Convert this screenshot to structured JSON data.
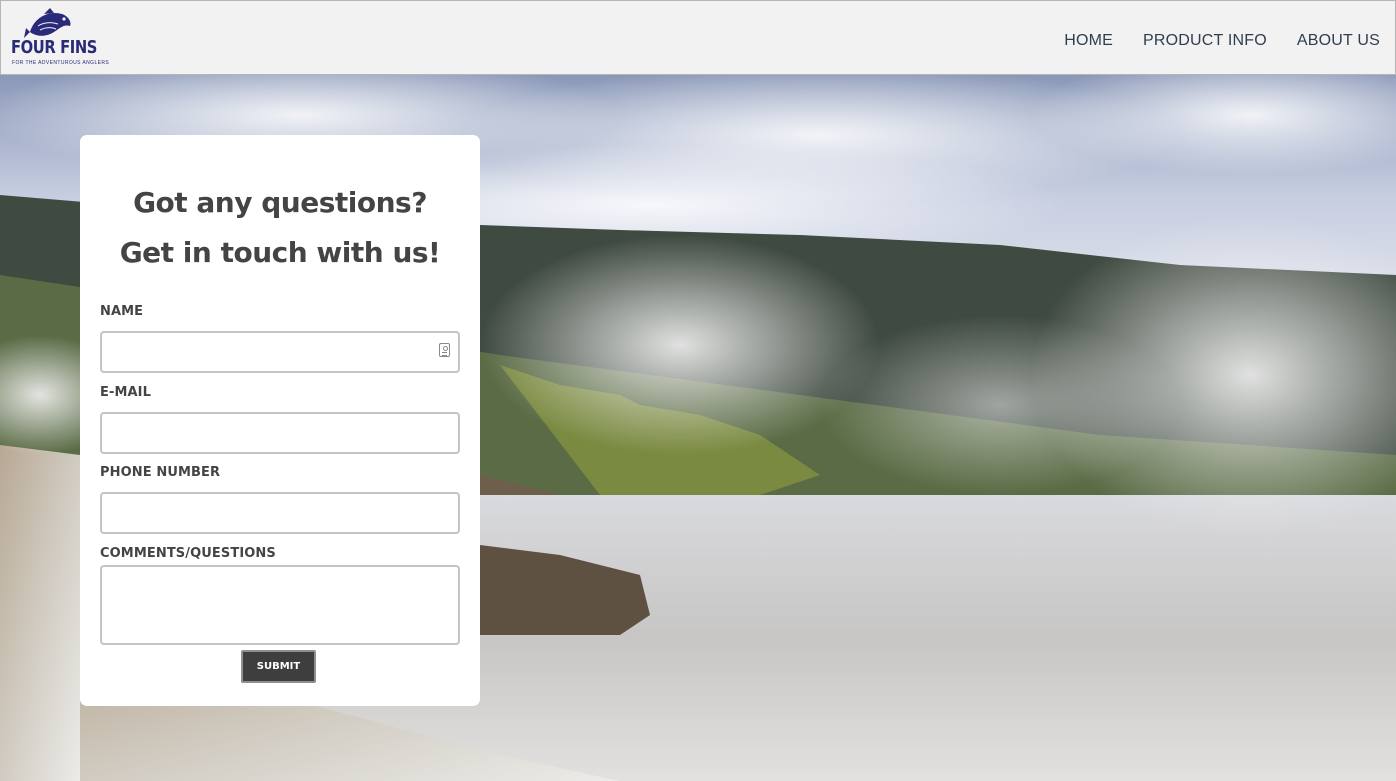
{
  "brand": {
    "name": "FOUR FINS",
    "tagline": "FOR THE ADVENTUROUS ANGLERS",
    "color": "#2a2a7a"
  },
  "nav": {
    "items": [
      {
        "label": "HOME"
      },
      {
        "label": "PRODUCT INFO"
      },
      {
        "label": "ABOUT US"
      }
    ]
  },
  "form": {
    "heading_line1": "Got any questions?",
    "heading_line2": "Get in touch with us!",
    "name_label": "NAME",
    "name_value": "",
    "email_label": "E-MAIL",
    "email_value": "",
    "phone_label": "PHONE NUMBER",
    "phone_value": "",
    "comments_label": "COMMENTS/QUESTIONS",
    "comments_value": "",
    "submit_label": "SUBMIT"
  },
  "icons": {
    "name_field_icon": "contact-card-icon",
    "logo_icon": "fish-icon"
  },
  "colors": {
    "header_bg": "#f2f2f2",
    "nav_text": "#2f3e4e",
    "heading_text": "#444444",
    "submit_bg": "#3e3e3e"
  }
}
